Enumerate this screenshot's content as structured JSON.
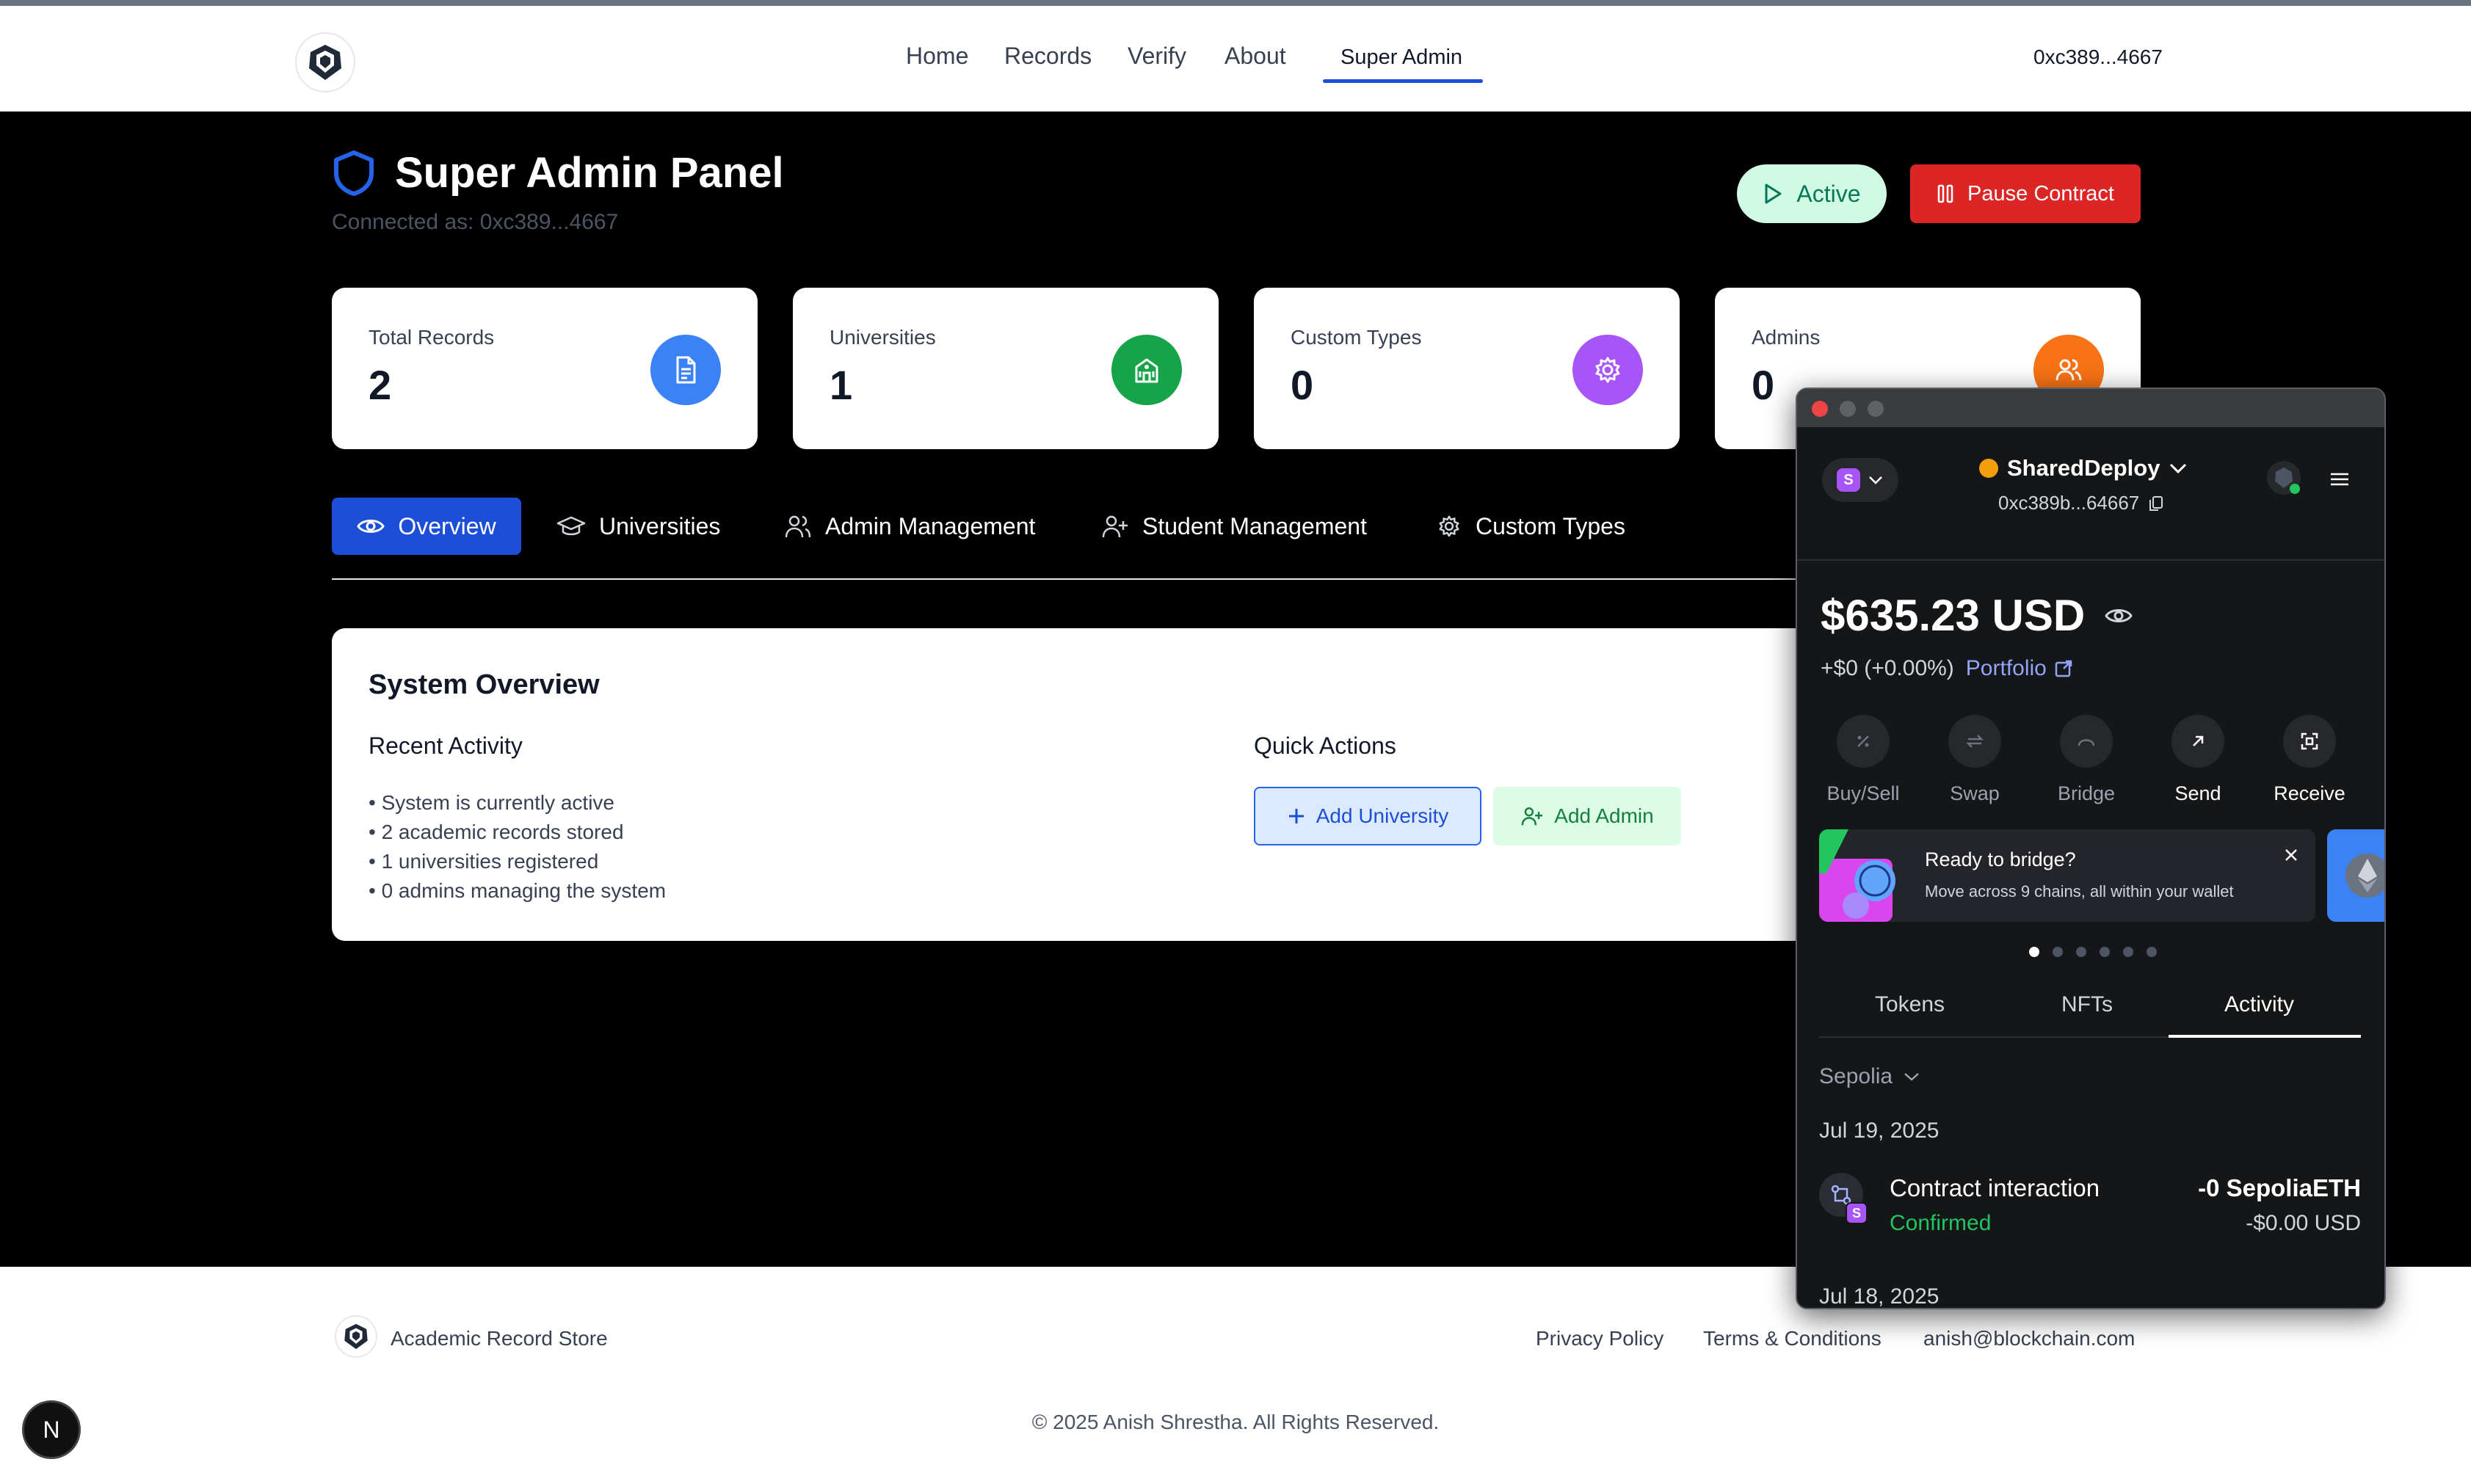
{
  "nav": {
    "links": [
      "Home",
      "Records",
      "Verify",
      "About",
      "Super Admin"
    ],
    "account": "0xc389...4667"
  },
  "header": {
    "title": "Super Admin Panel",
    "connected": "Connected as: 0xc389...4667",
    "status_label": "Active",
    "pause_label": "Pause Contract"
  },
  "stats": [
    {
      "label": "Total Records",
      "value": "2",
      "color": "#3b82f6",
      "icon": "document-icon"
    },
    {
      "label": "Universities",
      "value": "1",
      "color": "#16a34a",
      "icon": "building-icon"
    },
    {
      "label": "Custom Types",
      "value": "0",
      "color": "#a855f7",
      "icon": "gear-icon"
    },
    {
      "label": "Admins",
      "value": "0",
      "color": "#f97316",
      "icon": "users-icon"
    }
  ],
  "tabs": [
    "Overview",
    "Universities",
    "Admin Management",
    "Student Management",
    "Custom Types"
  ],
  "overview": {
    "title": "System Overview",
    "recent_title": "Recent Activity",
    "activity": [
      "• System is currently active",
      "• 2 academic records stored",
      "• 1 universities registered",
      "• 0 admins managing the system"
    ],
    "quick_title": "Quick Actions",
    "add_university": "Add University",
    "add_admin": "Add Admin"
  },
  "footer": {
    "brand": "Academic Record Store",
    "links": [
      "Privacy Policy",
      "Terms & Conditions",
      "anish@blockchain.com"
    ],
    "copyright": "© 2025 Anish Shrestha. All Rights Reserved."
  },
  "n_badge": "N",
  "wallet": {
    "network_badge": "S",
    "account_name": "SharedDeploy",
    "account_addr": "0xc389b...64667",
    "balance": "$635.23 USD",
    "change": "+$0 (+0.00%)",
    "portfolio": "Portfolio",
    "actions": [
      "Buy/Sell",
      "Swap",
      "Bridge",
      "Send",
      "Receive"
    ],
    "promo_title": "Ready to bridge?",
    "promo_sub": "Move across 9 chains, all within your wallet",
    "tabs": [
      "Tokens",
      "NFTs",
      "Activity"
    ],
    "network_filter": "Sepolia",
    "date1": "Jul 19, 2025",
    "tx_title": "Contract interaction",
    "tx_status": "Confirmed",
    "tx_amount": "-0 SepoliaETH",
    "tx_usd": "-$0.00 USD",
    "date2": "Jul 18, 2025"
  }
}
